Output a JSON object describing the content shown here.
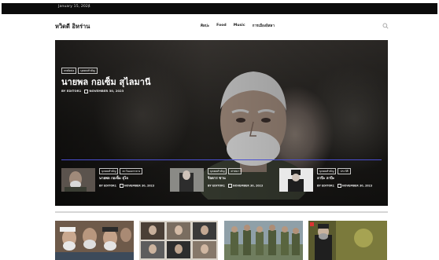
{
  "topbar": {
    "date": "January 15, 2024",
    "separator": "|"
  },
  "header": {
    "logo": "หวิดดี อิหร่าน",
    "nav": [
      "ศิลปะ",
      "Food",
      "Music",
      "การเมืองอิสลา"
    ],
    "search_icon": "search-icon"
  },
  "hero": {
    "tags": [
      "บทคัดย่อ",
      "บุคคลสำคัญ"
    ],
    "title": "นายพล กอเซ็ม สุไลมานี",
    "author": "BY EDITOR1",
    "date": "NOVEMBER 30, 2023"
  },
  "cards": [
    {
      "tags": [
        "บุคคลสำคัญ",
        "ตะวันออกกลาง"
      ],
      "title": "นายพล กอเซ็ม สุไล",
      "author": "BY EDITOR1",
      "date": "NOVEMBER 30, 2023"
    },
    {
      "tags": [
        "บุคคลสำคัญ",
        "ศาสนา"
      ],
      "title": "ริลดาร ซาน",
      "author": "BY EDITOR1",
      "date": "NOVEMBER 30, 2023"
    },
    {
      "tags": [
        "บุคคลสำคัญ",
        "ประวัติ"
      ],
      "title": "ลาปีะ ลาปีะ",
      "author": "BY EDITOR1",
      "date": "NOVEMBER 30, 2023"
    }
  ],
  "colors": {
    "topbar": "#0b0b0b",
    "accent_line": "#4a4fd2",
    "text_dark": "#1d1d1d"
  }
}
